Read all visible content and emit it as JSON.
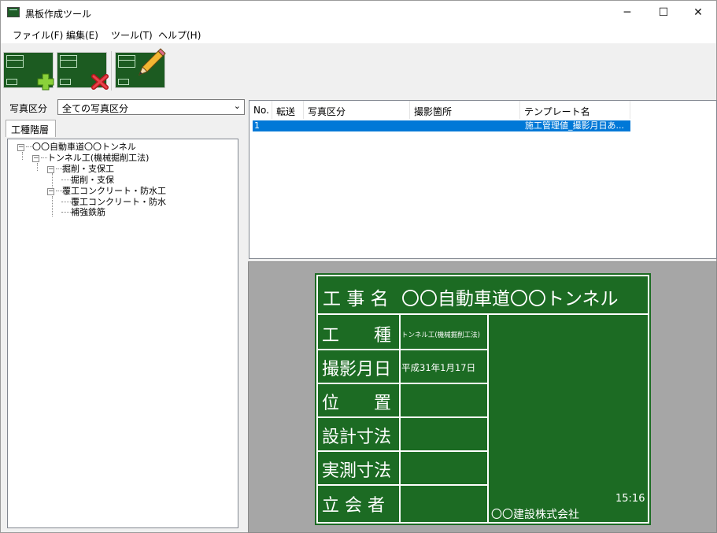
{
  "window": {
    "title": "黒板作成ツール",
    "controls": {
      "minimize": "─",
      "maximize": "☐",
      "close": "✕"
    }
  },
  "menu": [
    "ファイル(F)",
    "編集(E)",
    "ツール(T)",
    "ヘルプ(H)"
  ],
  "toolbar": {
    "buttons": [
      "add-board",
      "delete-board",
      "edit-board"
    ]
  },
  "filter": {
    "label": "写真区分",
    "selected": "全ての写真区分"
  },
  "tree": {
    "tab_label": "工種階層",
    "items": [
      {
        "label": "〇〇自動車道〇〇トンネル",
        "level": 0,
        "toggle": "−"
      },
      {
        "label": "トンネル工(機械掘削工法)",
        "level": 1,
        "toggle": "−"
      },
      {
        "label": "掘削・支保工",
        "level": 2,
        "toggle": "−"
      },
      {
        "label": "掘削・支保",
        "level": 3
      },
      {
        "label": "覆工コンクリート・防水工",
        "level": 2,
        "toggle": "−"
      },
      {
        "label": "覆工コンクリート・防水",
        "level": 3
      },
      {
        "label": "補強鉄筋",
        "level": 3
      }
    ]
  },
  "list": {
    "columns": [
      "No.",
      "転送",
      "写真区分",
      "撮影箇所",
      "テンプレート名"
    ],
    "rows": [
      {
        "no": "1",
        "transfer": "",
        "category": "",
        "location": "",
        "template": "施工管理値_撮影月日あ..."
      }
    ]
  },
  "board": {
    "title_label": "工 事 名",
    "title_value": "〇〇自動車道〇〇トンネル",
    "rows": [
      {
        "label": "工　　種",
        "value": "トンネル工(機械掘削工法)"
      },
      {
        "label": "撮影月日",
        "value": "平成31年1月17日"
      },
      {
        "label": "位　　置",
        "value": ""
      },
      {
        "label": "設計寸法",
        "value": ""
      },
      {
        "label": "実測寸法",
        "value": ""
      },
      {
        "label": "立 会 者",
        "value": ""
      }
    ],
    "time": "15:16",
    "company": "〇〇建設株式会社",
    "colors": {
      "board": "#1c6b23",
      "lines": "#ffffff",
      "text": "#ffffff"
    }
  }
}
